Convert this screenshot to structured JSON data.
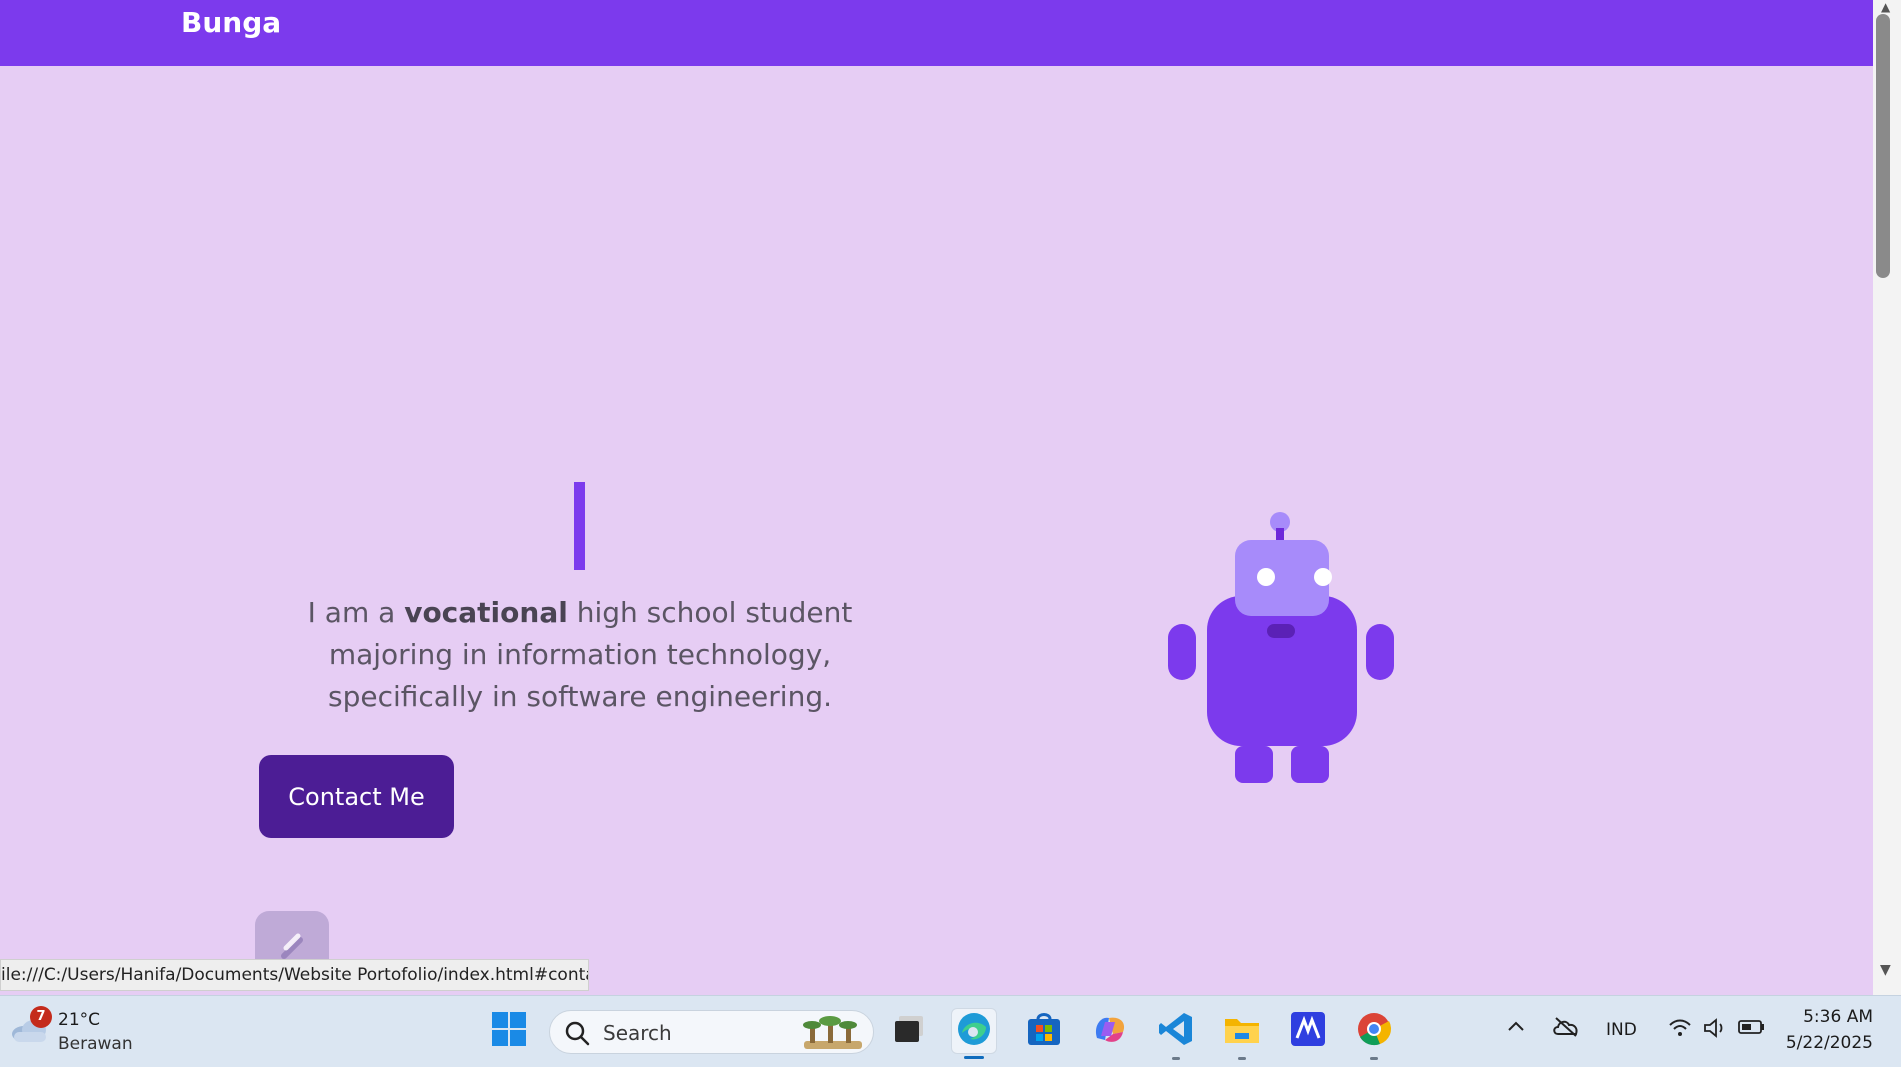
{
  "site": {
    "brand": "Bunga"
  },
  "hero": {
    "bio_prefix": "I am a ",
    "bio_bold": "vocational",
    "bio_suffix": " high school student majoring in information technology, specifically in software engineering.",
    "contact_label": "Contact Me"
  },
  "browser": {
    "status_url": "ile:///C:/Users/Hanifa/Documents/Website Portofolio/index.html#contact"
  },
  "taskbar": {
    "weather": {
      "badge": "7",
      "temp": "21°C",
      "condition": "Berawan"
    },
    "search_placeholder": "Search",
    "language": "IND",
    "time": "5:36 AM",
    "date": "5/22/2025"
  },
  "colors": {
    "nav": "#7c3aed",
    "page_bg": "#e6cdf4",
    "button": "#4c1d95",
    "robot_primary": "#7c3aed",
    "robot_head": "#a78bfa"
  }
}
